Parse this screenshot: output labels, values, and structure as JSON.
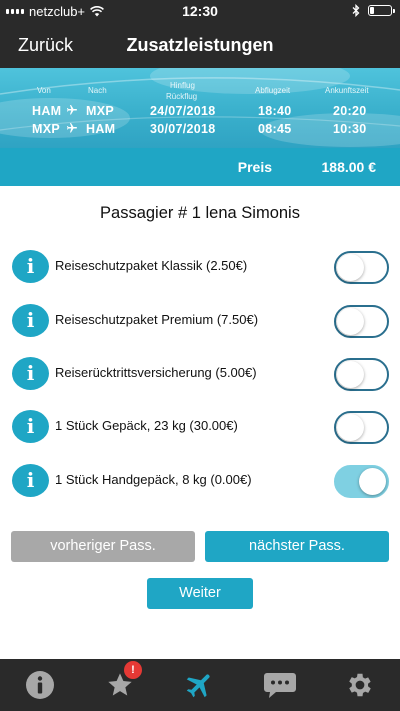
{
  "status_bar": {
    "carrier": "netzclub+",
    "time": "12:30",
    "battery_level": 0.2
  },
  "nav": {
    "back_label": "Zurück",
    "title": "Zusatzleistungen"
  },
  "flight": {
    "col_from": "Von",
    "col_to": "Nach",
    "col_date_out": "Hinflug",
    "col_date_return": "Rückflug",
    "col_departure": "Abflugzeit",
    "col_arrival": "Ankunftszeit",
    "legs": [
      {
        "from": "HAM",
        "to": "MXP",
        "date": "24/07/2018",
        "departure": "18:40",
        "arrival": "20:20"
      },
      {
        "from": "MXP",
        "to": "HAM",
        "date": "30/07/2018",
        "departure": "08:45",
        "arrival": "10:30"
      }
    ]
  },
  "price": {
    "label": "Preis",
    "value": "188.00 €"
  },
  "passenger_title": "Passagier # 1 lena Simonis",
  "options": [
    {
      "label": "Reiseschutzpaket Klassik (2.50€)",
      "enabled": false
    },
    {
      "label": "Reiseschutzpaket Premium (7.50€)",
      "enabled": false
    },
    {
      "label": "Reiserücktrittsversicherung (5.00€)",
      "enabled": false
    },
    {
      "label": "1 Stück Gepäck, 23 kg (30.00€)",
      "enabled": false
    },
    {
      "label": "1 Stück Handgepäck, 8 kg (0.00€)",
      "enabled": true
    }
  ],
  "buttons": {
    "prev": "vorheriger Pass.",
    "next": "nächster Pass.",
    "weiter": "Weiter"
  },
  "tabs": [
    {
      "icon": "info-icon",
      "badge": ""
    },
    {
      "icon": "star-icon",
      "badge": "!"
    },
    {
      "icon": "airplane-icon",
      "badge": "",
      "active": true
    },
    {
      "icon": "chat-icon",
      "badge": ""
    },
    {
      "icon": "gear-icon",
      "badge": ""
    }
  ],
  "colors": {
    "accent": "#1fa6c5",
    "dark": "#2a2a2a",
    "toggle_on": "#7fd0e2",
    "badge": "#e53935",
    "muted_button": "#a8a8a8"
  }
}
